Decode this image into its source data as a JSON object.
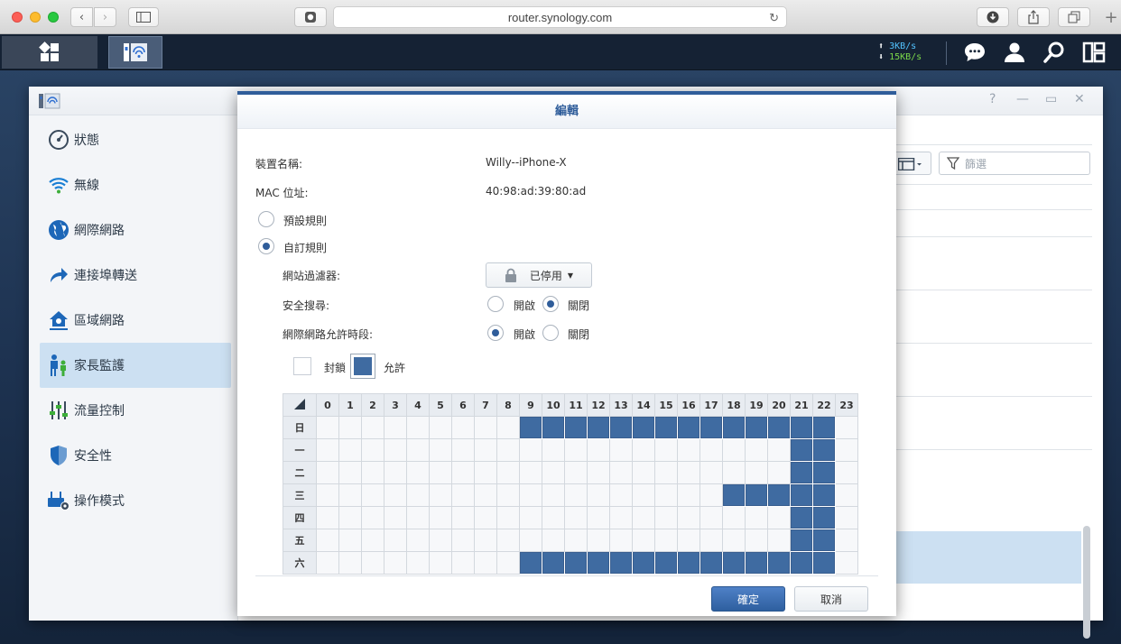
{
  "browser": {
    "url": "router.synology.com"
  },
  "taskbar": {
    "upload_speed": "3KB/s",
    "download_speed": "15KB/s"
  },
  "sidebar": {
    "items": [
      {
        "label": "狀態",
        "icon": "speedometer-icon"
      },
      {
        "label": "無線",
        "icon": "wifi-icon"
      },
      {
        "label": "網際網路",
        "icon": "globe-icon"
      },
      {
        "label": "連接埠轉送",
        "icon": "forward-arrow-icon"
      },
      {
        "label": "區域網路",
        "icon": "home-network-icon"
      },
      {
        "label": "家長監護",
        "icon": "family-icon",
        "active": true
      },
      {
        "label": "流量控制",
        "icon": "sliders-icon"
      },
      {
        "label": "安全性",
        "icon": "shield-icon"
      },
      {
        "label": "操作模式",
        "icon": "router-gear-icon"
      }
    ]
  },
  "list_pane": {
    "filter_placeholder": "篩選"
  },
  "dialog": {
    "title": "編輯",
    "device_name_label": "裝置名稱:",
    "device_name_value": "Willy--iPhone-X",
    "mac_label": "MAC 位址:",
    "mac_value": "40:98:ad:39:80:ad",
    "rule_default": "預設規則",
    "rule_custom": "自訂規則",
    "rule_selected": "custom",
    "web_filter_label": "網站過濾器:",
    "web_filter_value": "已停用",
    "safe_search_label": "安全搜尋:",
    "safe_search_on": "開啟",
    "safe_search_off": "關閉",
    "safe_search_selected": "off",
    "internet_schedule_label": "網際網路允許時段:",
    "internet_schedule_on": "開啟",
    "internet_schedule_off": "關閉",
    "internet_schedule_selected": "on",
    "legend_block": "封鎖",
    "legend_allow": "允許",
    "ok_button": "確定",
    "cancel_button": "取消",
    "colors": {
      "allow": "#3f6ba1",
      "block": "#f7f8fa",
      "accent": "#2f5d9a"
    }
  },
  "schedule": {
    "hours": [
      "0",
      "1",
      "2",
      "3",
      "4",
      "5",
      "6",
      "7",
      "8",
      "9",
      "10",
      "11",
      "12",
      "13",
      "14",
      "15",
      "16",
      "17",
      "18",
      "19",
      "20",
      "21",
      "22",
      "23"
    ],
    "days": [
      {
        "label": "日",
        "allowed_hours": [
          9,
          10,
          11,
          12,
          13,
          14,
          15,
          16,
          17,
          18,
          19,
          20,
          21,
          22
        ]
      },
      {
        "label": "一",
        "allowed_hours": [
          21,
          22
        ]
      },
      {
        "label": "二",
        "allowed_hours": [
          21,
          22
        ]
      },
      {
        "label": "三",
        "allowed_hours": [
          18,
          19,
          20,
          21,
          22
        ]
      },
      {
        "label": "四",
        "allowed_hours": [
          21,
          22
        ]
      },
      {
        "label": "五",
        "allowed_hours": [
          21,
          22
        ]
      },
      {
        "label": "六",
        "allowed_hours": [
          9,
          10,
          11,
          12,
          13,
          14,
          15,
          16,
          17,
          18,
          19,
          20,
          21,
          22
        ]
      }
    ]
  }
}
